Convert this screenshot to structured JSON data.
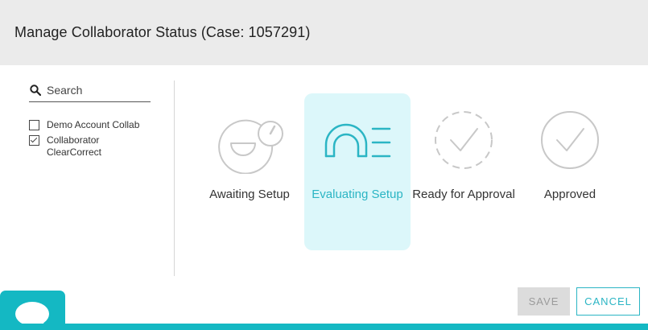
{
  "dialog": {
    "title": "Manage Collaborator Status (Case: 1057291)"
  },
  "search": {
    "placeholder": "Search",
    "value": ""
  },
  "collaborators": [
    {
      "label": "Demo Account Collab",
      "checked": false
    },
    {
      "label": "Collaborator ClearCorrect",
      "checked": true
    }
  ],
  "stages": [
    {
      "label": "Awaiting Setup",
      "icon": "gauge-smile-icon",
      "active": false
    },
    {
      "label": "Evaluating Setup",
      "icon": "aligner-list-icon",
      "active": true
    },
    {
      "label": "Ready for Approval",
      "icon": "dashed-check-circle-icon",
      "active": false
    },
    {
      "label": "Approved",
      "icon": "check-circle-icon",
      "active": false
    }
  ],
  "buttons": {
    "save_label": "SAVE",
    "cancel_label": "CANCEL"
  },
  "colors": {
    "accent": "#2bb5c4",
    "active_bg": "#dcf7fa",
    "header_bg": "#ebebeb",
    "chat_bg": "#14b8c3",
    "icon_gray": "#c8c8c8"
  }
}
